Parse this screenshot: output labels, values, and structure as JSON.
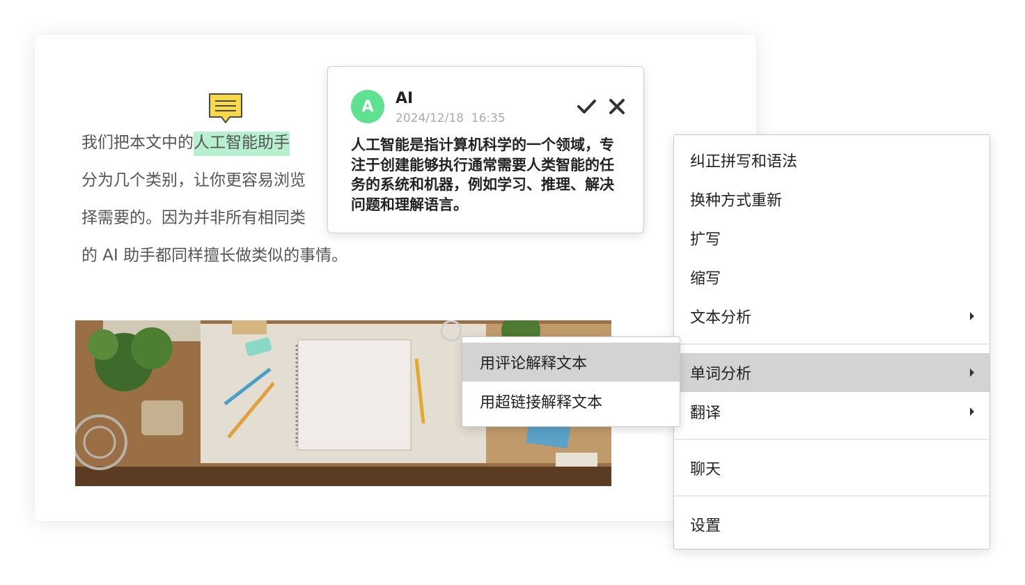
{
  "document": {
    "text_before_highlight": "我们把本文中的",
    "highlight_text": "人工智能助手",
    "line2": "分为几个类别，让你更容易浏览",
    "line3": "择需要的。因为并非所有相同类",
    "line4": "的 AI 助手都同样擅长做类似的事情。",
    "comment_marker_icon": "comment-icon",
    "highlight_color": "#b7f0cf"
  },
  "comment": {
    "avatar_letter": "A",
    "avatar_color": "#5ee28f",
    "author": "AI",
    "date": "2024/12/18",
    "time": "16:35",
    "body": "人工智能是指计算机科学的一个领域，专注于创建能够执行通常需要人类智能的任务的系统和机器，例如学习、推理、解决问题和理解语言。",
    "accept_icon": "check-icon",
    "close_icon": "close-icon"
  },
  "context_menu": {
    "items": [
      {
        "label": "纠正拼写和语法"
      },
      {
        "label": "换种方式重新"
      },
      {
        "label": "扩写"
      },
      {
        "label": "缩写"
      },
      {
        "label": "文本分析",
        "has_submenu": true
      },
      {
        "label": "单词分析",
        "has_submenu": true,
        "active": true
      },
      {
        "label": "翻译",
        "has_submenu": true
      },
      {
        "label": "聊天"
      },
      {
        "label": "设置"
      }
    ]
  },
  "submenu": {
    "items": [
      {
        "label": "用评论解释文本",
        "active": true
      },
      {
        "label": "用超链接解释文本"
      }
    ]
  }
}
